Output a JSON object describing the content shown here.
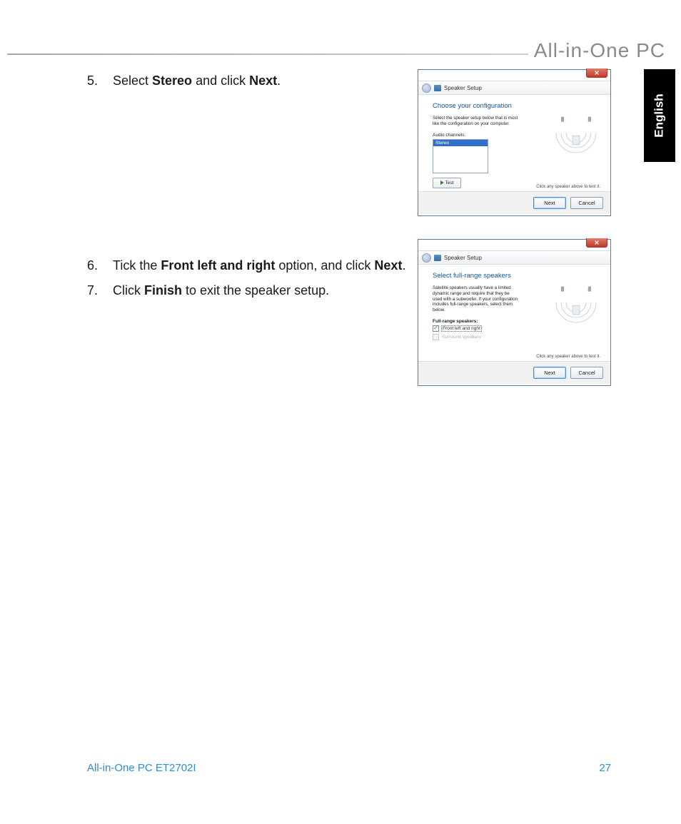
{
  "header": {
    "brand": "All-in-One PC"
  },
  "lang_tab": "English",
  "steps": {
    "s5": {
      "num": "5.",
      "pre": "Select ",
      "b1": "Stereo",
      "mid": " and click ",
      "b2": "Next",
      "post": "."
    },
    "s6": {
      "num": "6.",
      "pre": "Tick the ",
      "b1": "Front left and right",
      "mid": " option, and click ",
      "b2": "Next",
      "post": "."
    },
    "s7": {
      "num": "7.",
      "pre": "Click ",
      "b1": "Finish",
      "post": " to exit the speaker setup."
    }
  },
  "dialog1": {
    "window_title": "Speaker Setup",
    "heading": "Choose your configuration",
    "desc": "Select the speaker setup below that is most like the configuration on your computer.",
    "channels_label": "Audio channels:",
    "list_selected": "Stereo",
    "test_label": "Test",
    "hint": "Click any speaker above to test it.",
    "next": "Next",
    "cancel": "Cancel"
  },
  "dialog2": {
    "window_title": "Speaker Setup",
    "heading": "Select full-range speakers",
    "desc": "Satellite speakers usually have a limited dynamic range and require that they be used with a subwoofer. If your configuration includes full-range speakers, select them below.",
    "section_label": "Full-range speakers:",
    "opt1": "Front left and right",
    "opt2": "Surround speakers",
    "hint": "Click any speaker above to test it.",
    "next": "Next",
    "cancel": "Cancel"
  },
  "footer": {
    "model": "All-in-One PC ET2702I",
    "page": "27"
  }
}
